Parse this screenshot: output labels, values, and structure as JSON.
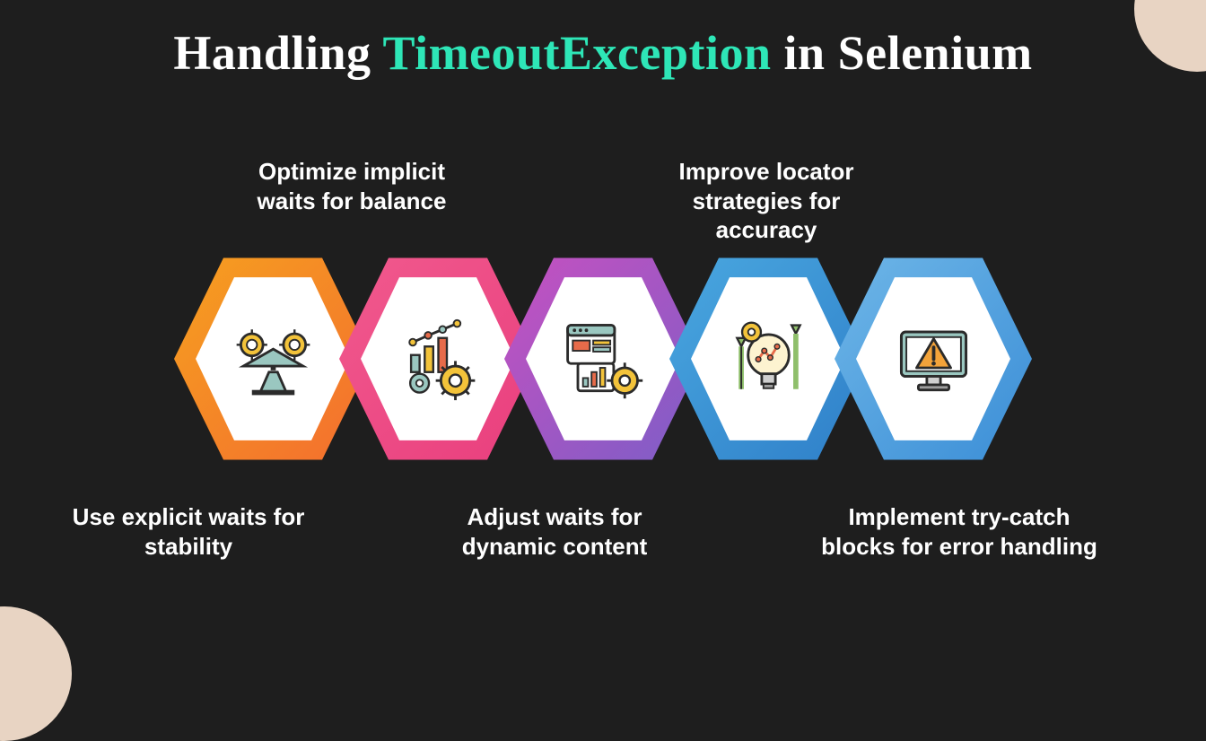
{
  "title": {
    "pre": "Handling ",
    "highlight": "TimeoutException",
    "post": " in Selenium"
  },
  "items": [
    {
      "label": "Use explicit waits for stability",
      "icon": "balance-scale",
      "position": "bottom"
    },
    {
      "label": "Optimize implicit waits for balance",
      "icon": "analytics-gears",
      "position": "top"
    },
    {
      "label": "Adjust waits for dynamic content",
      "icon": "dashboard-browser",
      "position": "bottom"
    },
    {
      "label": "Improve locator strategies for accuracy",
      "icon": "idea-growth",
      "position": "top"
    },
    {
      "label": "Implement try-catch blocks for error handling",
      "icon": "monitor-warning",
      "position": "bottom"
    }
  ],
  "colors": {
    "bg": "#1e1e1e",
    "accent": "#2ee6b7",
    "corner": "#e8d4c3",
    "gradients": [
      "#f6a11f-#f36c2f",
      "#f15a8e-#e93e7d",
      "#c850c0-#7b5ec7",
      "#4aa8e0-#2e7ec8",
      "#6fb7e8-#3a8dd6"
    ]
  }
}
